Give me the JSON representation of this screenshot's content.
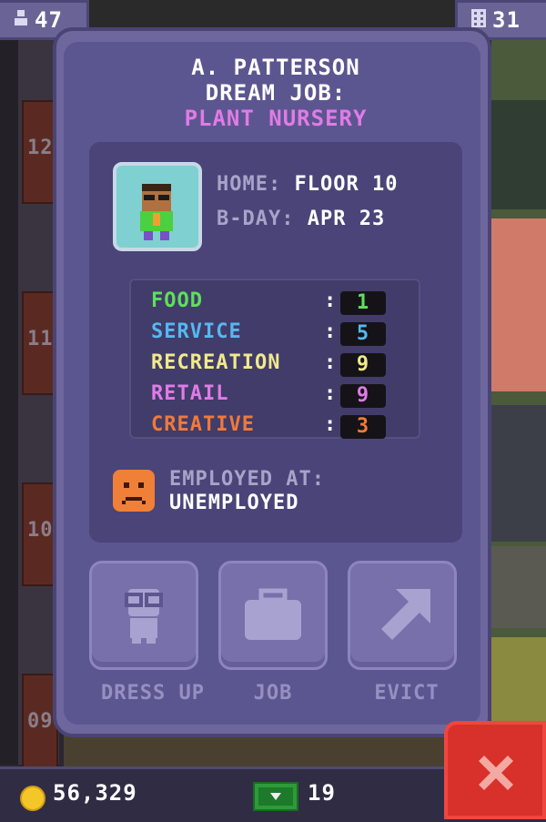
{
  "top": {
    "population": "47",
    "floors": "31"
  },
  "panel": {
    "name": "A. PATTERSON",
    "dream_job_label": "DREAM JOB:",
    "dream_job": "PLANT NURSERY",
    "home_label": "HOME:",
    "home_value": "FLOOR 10",
    "bday_label": "B-DAY:",
    "bday_value": "APR 23",
    "skills": [
      {
        "name": "FOOD",
        "value": "1",
        "color": "#5ee05a"
      },
      {
        "name": "SERVICE",
        "value": "5",
        "color": "#56b8f0"
      },
      {
        "name": "RECREATION",
        "value": "9",
        "color": "#f0ea8a"
      },
      {
        "name": "RETAIL",
        "value": "9",
        "color": "#e07be6"
      },
      {
        "name": "CREATIVE",
        "value": "3",
        "color": "#f07a3a"
      }
    ],
    "employed_label": "EMPLOYED AT:",
    "employed_value": "UNEMPLOYED",
    "actions": {
      "dress_up": "DRESS UP",
      "job": "JOB",
      "evict": "EVICT"
    }
  },
  "bottom": {
    "coins": "56,329",
    "bux": "19"
  },
  "background": {
    "floor_numbers": [
      "12",
      "11",
      "10",
      "09"
    ]
  },
  "icons": [
    "people-icon",
    "building-icon",
    "frown-face-icon",
    "glasses-person-icon",
    "briefcase-icon",
    "arrow-up-right-icon",
    "coin-icon",
    "cash-icon",
    "close-x-icon"
  ]
}
